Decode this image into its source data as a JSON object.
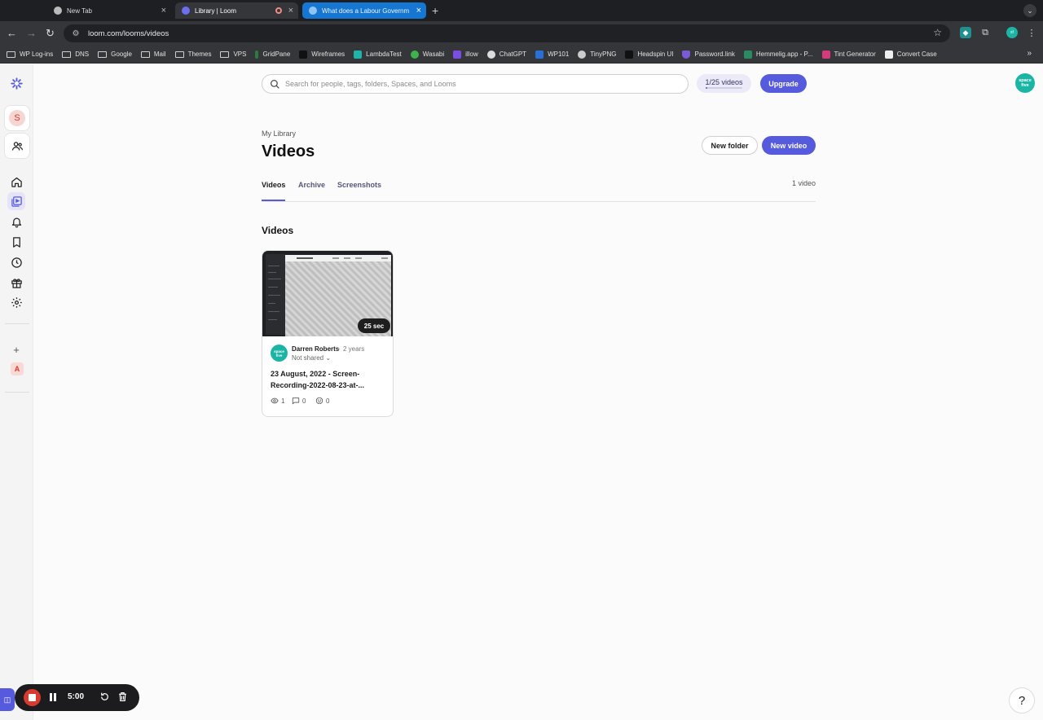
{
  "browser": {
    "tabs": [
      {
        "title": "New Tab"
      },
      {
        "title": "Library | Loom"
      },
      {
        "title": "What does a Labour Governm"
      }
    ],
    "url": "loom.com/looms/videos",
    "bookmarks": [
      {
        "label": "WP Log-ins",
        "icon": "folder-icon"
      },
      {
        "label": "DNS",
        "icon": "folder-icon"
      },
      {
        "label": "Google",
        "icon": "folder-icon"
      },
      {
        "label": "Mail",
        "icon": "folder-icon"
      },
      {
        "label": "Themes",
        "icon": "folder-icon"
      },
      {
        "label": "VPS",
        "icon": "folder-icon"
      },
      {
        "label": "GridPane",
        "icon": "gridpane-icon",
        "color": "#2c7b3d"
      },
      {
        "label": "Wireframes",
        "icon": "wireframes-icon",
        "color": "#111111"
      },
      {
        "label": "LambdaTest",
        "icon": "lambdatest-icon",
        "color": "#1fb3a9"
      },
      {
        "label": "Wasabi",
        "icon": "wasabi-icon",
        "color": "#3cb44b"
      },
      {
        "label": "illow",
        "icon": "illow-icon",
        "color": "#7b4ee0"
      },
      {
        "label": "ChatGPT",
        "icon": "chatgpt-icon",
        "color": "#dddddd"
      },
      {
        "label": "WP101",
        "icon": "wp101-icon",
        "color": "#2a6fd6"
      },
      {
        "label": "TinyPNG",
        "icon": "tinypng-icon",
        "color": "#cccccc"
      },
      {
        "label": "Headspin UI",
        "icon": "headspin-icon",
        "color": "#111111"
      },
      {
        "label": "Password.link",
        "icon": "passwordlink-icon",
        "color": "#7a5bd6"
      },
      {
        "label": "Hemmelig.app - P...",
        "icon": "hemmelig-icon",
        "color": "#2a8a62"
      },
      {
        "label": "Tint Generator",
        "icon": "tint-icon",
        "color": "#d63a7a"
      },
      {
        "label": "Convert Case",
        "icon": "convertcase-icon",
        "color": "#eeeeee"
      }
    ]
  },
  "search": {
    "placeholder": "Search for people, tags, folders, Spaces, and Looms"
  },
  "header": {
    "quota": "1/25 videos",
    "quota_fraction": 0.04,
    "upgrade": "Upgrade",
    "avatar_text": "space five"
  },
  "workspace": {
    "initial": "S",
    "second_initial": "A"
  },
  "page": {
    "breadcrumb": "My Library",
    "title": "Videos",
    "new_folder": "New folder",
    "new_video": "New video",
    "tabs": [
      "Videos",
      "Archive",
      "Screenshots"
    ],
    "count": "1 video",
    "section_title": "Videos"
  },
  "video": {
    "duration": "25 sec",
    "author": "Darren Roberts",
    "age": "2 years",
    "sharing": "Not shared",
    "title": "23 August, 2022 - Screen-Recording-2022-08-23-at-...",
    "views": "1",
    "comments": "0",
    "reactions": "0"
  },
  "recorder": {
    "time": "5:00"
  },
  "help": "?",
  "colors": {
    "accent": "#565add",
    "record": "#d83a2f",
    "avatar": "#1ab5a5"
  }
}
